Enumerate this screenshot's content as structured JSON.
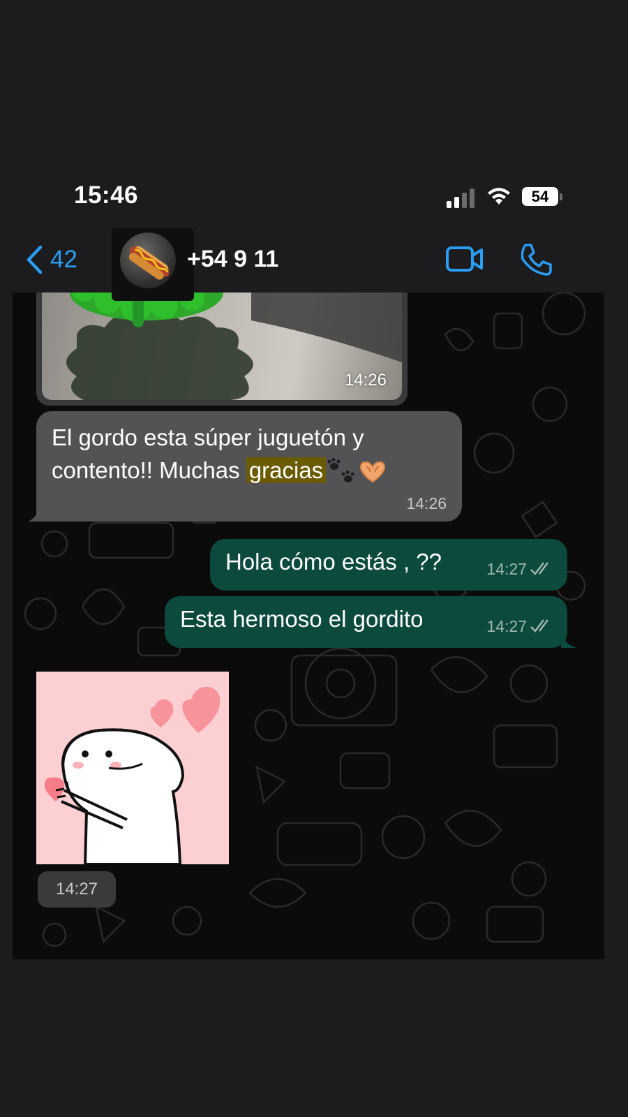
{
  "status_bar": {
    "time": "15:46",
    "battery": "54",
    "icons": [
      "signal-icon",
      "wifi-icon",
      "battery-icon"
    ]
  },
  "header": {
    "back_count": "42",
    "contact_name": "+54 9 11",
    "avatar_emoji": "hotdog",
    "actions": [
      "video-call-icon",
      "phone-icon"
    ],
    "accent_color": "#2a9df4"
  },
  "messages": [
    {
      "type": "image",
      "direction": "incoming",
      "time": "14:26"
    },
    {
      "type": "text",
      "direction": "incoming",
      "text_before": "El gordo esta súper juguetón y contento!! Muchas ",
      "highlight": "gracias",
      "emojis": [
        "paw-prints-icon",
        "heart-hands-icon"
      ],
      "time": "14:26"
    },
    {
      "type": "text",
      "direction": "outgoing",
      "text": "Hola cómo estás , ??",
      "time": "14:27",
      "status": "read"
    },
    {
      "type": "text",
      "direction": "outgoing",
      "text": "Esta hermoso el gordito",
      "time": "14:27",
      "status": "read"
    },
    {
      "type": "sticker",
      "direction": "incoming",
      "time": "14:27"
    }
  ],
  "colors": {
    "incoming_bubble": "#535356",
    "outgoing_bubble": "#0c4a3e",
    "highlight": "#6a5a00",
    "chat_bg": "#0b0b0c"
  }
}
